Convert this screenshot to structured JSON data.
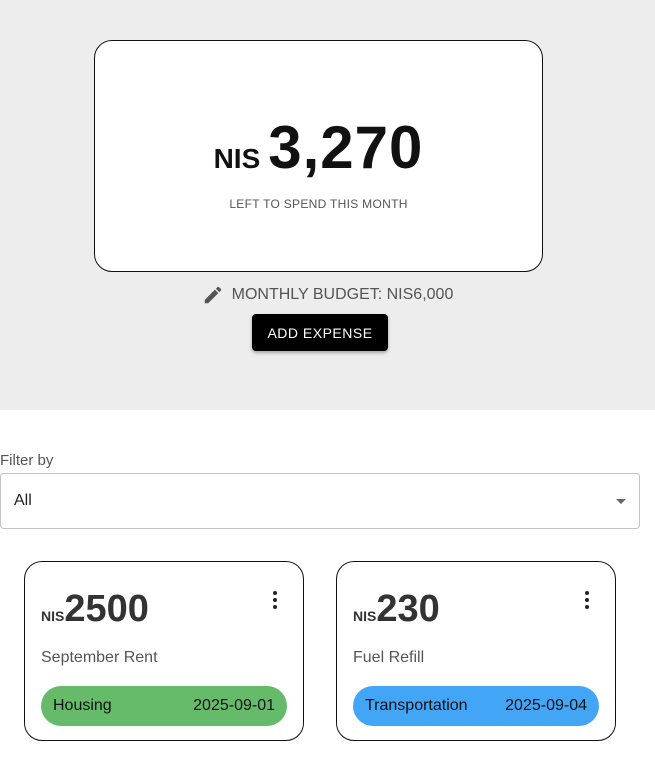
{
  "summary": {
    "currency": "NIS",
    "remaining": "3,270",
    "label": "LEFT TO SPEND THIS MONTH",
    "budget_text": "MONTHLY BUDGET: NIS6,000",
    "edit_icon": "pencil-icon",
    "add_button": "ADD EXPENSE"
  },
  "filter": {
    "label": "Filter by",
    "value": "All",
    "icon": "dropdown-arrow-icon"
  },
  "expenses": [
    {
      "currency": "NIS",
      "amount": "2500",
      "title": "September Rent",
      "category": "Housing",
      "date": "2025-09-01",
      "category_color": "#66bb6a",
      "menu_icon": "more-vert-icon"
    },
    {
      "currency": "NIS",
      "amount": "230",
      "title": "Fuel Refill",
      "category": "Transportation",
      "date": "2025-09-04",
      "category_color": "#42a5f5",
      "menu_icon": "more-vert-icon"
    }
  ]
}
